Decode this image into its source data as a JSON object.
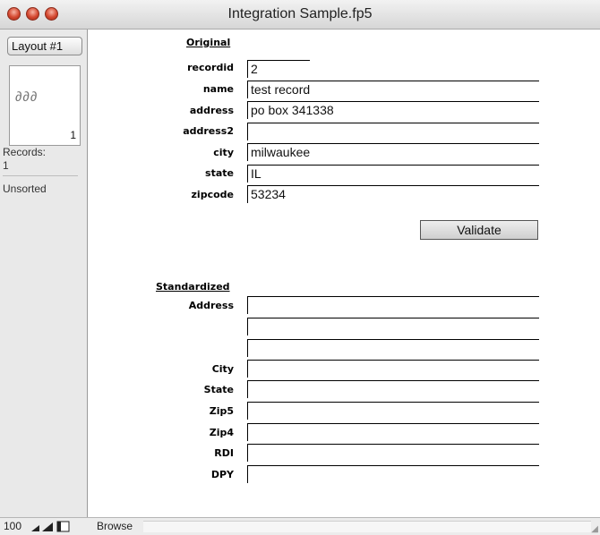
{
  "window": {
    "title": "Integration Sample.fp5",
    "controls": [
      "close-icon",
      "minimize-icon",
      "zoom-icon"
    ]
  },
  "sidebar": {
    "layout_label": "Layout #1",
    "book_icon": "book-icon",
    "record_number": "1",
    "records_label": "Records:",
    "records_count": "1",
    "sort_status": "Unsorted"
  },
  "original": {
    "heading": "Original",
    "fields": [
      {
        "label": "recordid",
        "value": "2"
      },
      {
        "label": "name",
        "value": "test record"
      },
      {
        "label": "address",
        "value": "po box 341338"
      },
      {
        "label": "address2",
        "value": ""
      },
      {
        "label": "city",
        "value": "milwaukee"
      },
      {
        "label": "state",
        "value": "IL"
      },
      {
        "label": "zipcode",
        "value": "53234"
      }
    ]
  },
  "validate_label": "Validate",
  "standardized": {
    "heading": "Standardized",
    "fields": [
      {
        "label": "Address",
        "value": ""
      },
      {
        "label": "",
        "value": ""
      },
      {
        "label": "",
        "value": ""
      },
      {
        "label": "City",
        "value": ""
      },
      {
        "label": "State",
        "value": ""
      },
      {
        "label": "Zip5",
        "value": ""
      },
      {
        "label": "Zip4",
        "value": ""
      },
      {
        "label": "RDI",
        "value": ""
      },
      {
        "label": "DPY",
        "value": ""
      }
    ]
  },
  "statusbar": {
    "zoom": "100",
    "mode": "Browse",
    "icons": [
      "zoom-out-icon",
      "zoom-in-icon",
      "status-area-toggle-icon"
    ]
  }
}
